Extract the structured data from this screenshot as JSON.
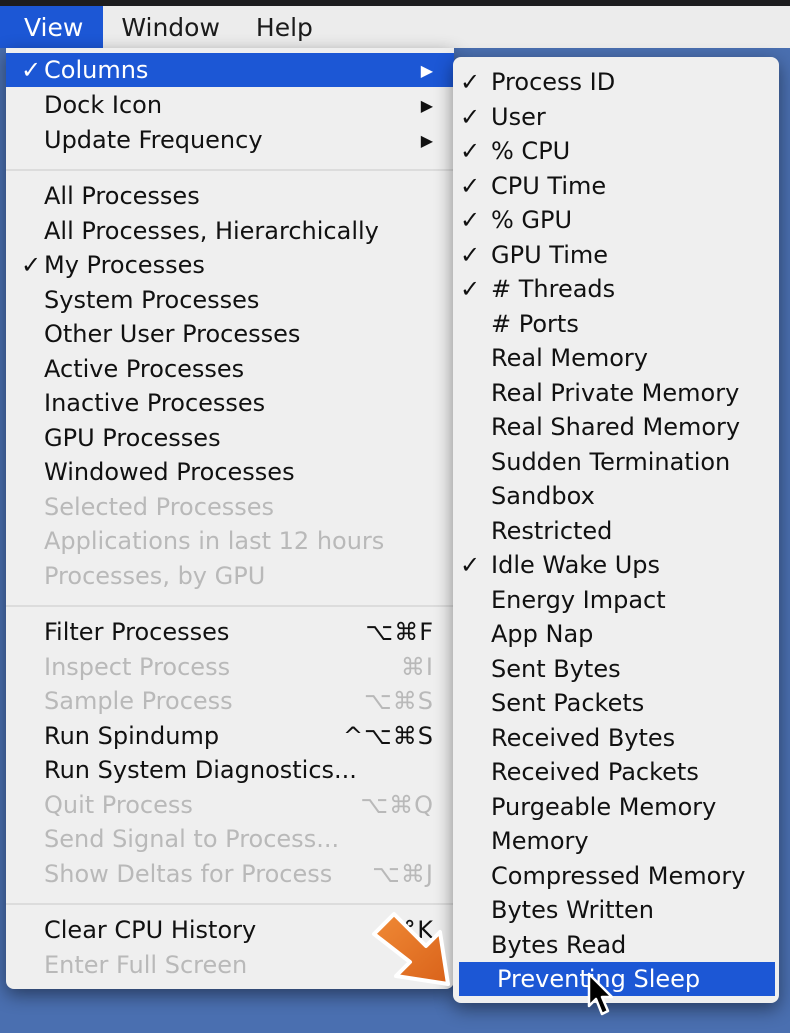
{
  "menubar": {
    "view": "View",
    "window": "Window",
    "help": "Help"
  },
  "view_menu": {
    "columns": "Columns",
    "dock_icon": "Dock Icon",
    "update_frequency": "Update Frequency",
    "all_processes": "All Processes",
    "all_processes_hier": "All Processes, Hierarchically",
    "my_processes": "My Processes",
    "system_processes": "System Processes",
    "other_user_processes": "Other User Processes",
    "active_processes": "Active Processes",
    "inactive_processes": "Inactive Processes",
    "gpu_processes": "GPU Processes",
    "windowed_processes": "Windowed Processes",
    "selected_processes": "Selected Processes",
    "applications_last_12": "Applications in last 12 hours",
    "processes_by_gpu": "Processes, by GPU",
    "filter_processes": "Filter Processes",
    "filter_processes_sc": "⌥⌘F",
    "inspect_process": "Inspect Process",
    "inspect_process_sc": "⌘I",
    "sample_process": "Sample Process",
    "sample_process_sc": "⌥⌘S",
    "run_spindump": "Run Spindump",
    "run_spindump_sc": "^⌥⌘S",
    "run_sysdiag": "Run System Diagnostics...",
    "quit_process": "Quit Process",
    "quit_process_sc": "⌥⌘Q",
    "send_signal": "Send Signal to Process...",
    "show_deltas": "Show Deltas for Process",
    "show_deltas_sc": "⌥⌘J",
    "clear_cpu_history": "Clear CPU History",
    "clear_cpu_history_sc": "⌘K",
    "enter_full_screen": "Enter Full Screen",
    "check": "✓",
    "submenu_arrow": "▶"
  },
  "columns_menu": {
    "items": [
      {
        "label": "Process ID",
        "checked": "✓"
      },
      {
        "label": "User",
        "checked": "✓"
      },
      {
        "label": "% CPU",
        "checked": "✓"
      },
      {
        "label": "CPU Time",
        "checked": "✓"
      },
      {
        "label": "% GPU",
        "checked": "✓"
      },
      {
        "label": "GPU Time",
        "checked": "✓"
      },
      {
        "label": "# Threads",
        "checked": "✓"
      },
      {
        "label": "# Ports",
        "checked": ""
      },
      {
        "label": "Real Memory",
        "checked": ""
      },
      {
        "label": "Real Private Memory",
        "checked": ""
      },
      {
        "label": "Real Shared Memory",
        "checked": ""
      },
      {
        "label": "Sudden Termination",
        "checked": ""
      },
      {
        "label": "Sandbox",
        "checked": ""
      },
      {
        "label": "Restricted",
        "checked": ""
      },
      {
        "label": "Idle Wake Ups",
        "checked": "✓"
      },
      {
        "label": "Energy Impact",
        "checked": ""
      },
      {
        "label": "App Nap",
        "checked": ""
      },
      {
        "label": "Sent Bytes",
        "checked": ""
      },
      {
        "label": "Sent Packets",
        "checked": ""
      },
      {
        "label": "Received Bytes",
        "checked": ""
      },
      {
        "label": "Received Packets",
        "checked": ""
      },
      {
        "label": "Purgeable Memory",
        "checked": ""
      },
      {
        "label": "Memory",
        "checked": ""
      },
      {
        "label": "Compressed Memory",
        "checked": ""
      },
      {
        "label": "Bytes Written",
        "checked": ""
      },
      {
        "label": "Bytes Read",
        "checked": ""
      },
      {
        "label": "Preventing Sleep",
        "checked": ""
      }
    ]
  },
  "colors": {
    "highlight": "#1c57d5",
    "menu_bg": "#efefef",
    "disabled_text": "#b9b9b9",
    "annotation_arrow": "#e8741f"
  }
}
